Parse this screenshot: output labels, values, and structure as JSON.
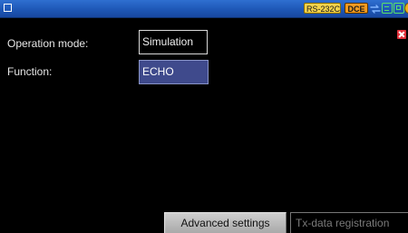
{
  "statusbar": {
    "menu_icon": "square-menu-icon",
    "interface_badge": "RS-232C",
    "role_badge": "DCE",
    "icons": [
      "link-arrows-icon",
      "serial-port-icon",
      "memory-card-icon",
      "more-status-icon"
    ],
    "colors": {
      "bar": "#1e57b6",
      "interface_badge": "#f2d24a",
      "role_badge": "#f29a1e",
      "status_icons": "#59e06a"
    }
  },
  "settings": {
    "operation_mode": {
      "label": "Operation mode:",
      "value": "Simulation"
    },
    "function": {
      "label": "Function:",
      "value": "ECHO",
      "selected": true
    },
    "close_icon": "close-x-icon"
  },
  "tabs": {
    "advanced_settings": "Advanced settings",
    "tx_data_registration": "Tx-data registration"
  },
  "colors": {
    "background": "#000000",
    "selection": "#3f4a8c",
    "close": "#e0303a"
  }
}
